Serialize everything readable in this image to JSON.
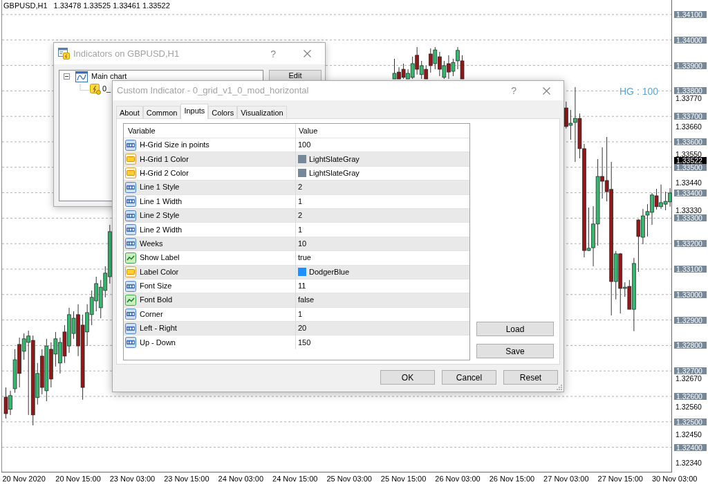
{
  "chart": {
    "symbol": "GBPUSD,H1",
    "quote": "1.33478 1.33525 1.33461 1.33522",
    "object_label": "HG : 100",
    "price_levels": [
      "1.34100",
      "1.34000",
      "1.33900",
      "1.33800",
      "1.33700",
      "1.33600",
      "1.33500",
      "1.33400",
      "1.33300",
      "1.33200",
      "1.33100",
      "1.33000",
      "1.32900",
      "1.32800",
      "1.32700",
      "1.32600",
      "1.32500",
      "1.32400"
    ],
    "current_price": "1.33522",
    "chart_data": {
      "type": "candlestick",
      "categories": [
        null,
        null,
        null,
        null,
        "20 Nov 2020",
        null,
        null,
        null,
        null,
        null,
        null,
        null,
        null,
        null,
        null,
        null,
        "20 Nov 15:00",
        null,
        null,
        null,
        null,
        null,
        null,
        null,
        null,
        null,
        null,
        null,
        "23 Nov 03:00",
        null,
        null,
        null,
        null,
        null,
        null,
        null,
        null,
        null,
        null,
        null,
        "23 Nov 15:00",
        null,
        null,
        null,
        null,
        null,
        null,
        null,
        null,
        null,
        null,
        null,
        "24 Nov 03:00",
        null,
        null,
        null,
        null,
        null,
        null,
        null,
        null,
        null,
        null,
        null,
        "24 Nov 15:00",
        null,
        null,
        null,
        null,
        null,
        null,
        null,
        null,
        null,
        null,
        null,
        "25 Nov 03:00",
        null,
        null,
        null,
        null,
        null,
        null,
        null,
        null,
        null,
        null,
        null,
        "25 Nov 15:00",
        null,
        null,
        null,
        null,
        null,
        null,
        null,
        null,
        null,
        null,
        null,
        "26 Nov 03:00",
        null,
        null,
        null,
        null,
        null,
        null,
        null,
        null,
        null,
        null,
        null,
        "26 Nov 15:00",
        null,
        null,
        null,
        null,
        null,
        null,
        null,
        null,
        null,
        null,
        null,
        "27 Nov 03:00",
        null,
        null,
        null,
        null,
        null,
        null,
        null,
        null,
        null,
        null,
        null,
        "27 Nov 15:00",
        null,
        null,
        null,
        null,
        null,
        null,
        null,
        null,
        null,
        null,
        null,
        "30 Nov 03:00"
      ],
      "ohlc": [
        [
          1.32597,
          1.32635,
          1.32513,
          1.32532
        ],
        [
          1.32549,
          1.32622,
          1.32527,
          1.32603
        ],
        [
          1.3263,
          1.32785,
          1.32614,
          1.32744
        ],
        [
          1.32804,
          1.32831,
          1.32635,
          1.3269
        ],
        [
          1.32777,
          1.32847,
          1.32744,
          1.32826
        ],
        [
          1.32812,
          1.32858,
          1.32527,
          1.32837
        ],
        [
          1.3282,
          1.32839,
          1.32486,
          1.32527
        ],
        [
          1.32595,
          1.32731,
          1.32568,
          1.3269
        ],
        [
          1.32758,
          1.32785,
          1.32608,
          1.32635
        ],
        [
          1.32622,
          1.32826,
          1.32581,
          1.32798
        ],
        [
          1.32785,
          1.32812,
          1.32635,
          1.32668
        ],
        [
          1.32766,
          1.32853,
          1.32717,
          1.32826
        ],
        [
          1.32731,
          1.32831,
          1.3269,
          1.32812
        ],
        [
          1.32853,
          1.3288,
          1.32731,
          1.32758
        ],
        [
          1.32798,
          1.32948,
          1.32771,
          1.32921
        ],
        [
          1.32847,
          1.32934,
          1.32826,
          1.32907
        ],
        [
          1.32921,
          1.32962,
          1.32758,
          1.32798
        ],
        [
          1.3288,
          1.32921,
          1.32587,
          1.32635
        ],
        [
          1.32853,
          1.32962,
          1.32798,
          1.32929
        ],
        [
          1.32921,
          1.33016,
          1.3288,
          1.32989
        ],
        [
          1.32975,
          1.3307,
          1.32934,
          1.33043
        ],
        [
          1.32948,
          1.33057,
          1.32907,
          1.33029
        ],
        [
          1.33016,
          1.33111,
          1.32989,
          1.33084
        ],
        [
          1.3307,
          1.33274,
          1.33043,
          1.33247
        ],
        null,
        null,
        null,
        null,
        null,
        null,
        null,
        null,
        null,
        null,
        null,
        null,
        null,
        null,
        null,
        null,
        null,
        null,
        null,
        null,
        null,
        null,
        null,
        null,
        null,
        null,
        null,
        null,
        null,
        null,
        null,
        null,
        null,
        null,
        null,
        null,
        null,
        null,
        null,
        null,
        null,
        null,
        null,
        null,
        null,
        null,
        null,
        null,
        null,
        null,
        null,
        null,
        null,
        null,
        null,
        null,
        null,
        null,
        null,
        null,
        null,
        null,
        [
          1.33847,
          1.33926,
          1.33847,
          1.33869
        ],
        [
          1.33874,
          1.33893,
          1.33847,
          1.33847
        ],
        [
          1.33885,
          1.33907,
          1.33847,
          1.33853
        ],
        [
          1.33847,
          1.33885,
          1.33847,
          1.33869
        ],
        [
          1.33853,
          1.33934,
          1.33847,
          1.33907
        ],
        [
          1.3394,
          1.33972,
          1.33864,
          1.33885
        ],
        [
          1.33864,
          1.33918,
          1.33847,
          1.33899
        ],
        [
          1.33885,
          1.33899,
          1.33847,
          1.33847
        ],
        [
          1.33945,
          1.33967,
          1.33872,
          1.33899
        ],
        [
          1.33907,
          1.33972,
          1.33885,
          1.33961
        ],
        [
          1.33934,
          1.33953,
          1.33858,
          1.33885
        ],
        [
          1.33853,
          1.33918,
          1.33847,
          1.33899
        ],
        [
          1.33907,
          1.3394,
          1.33847,
          1.33874
        ],
        [
          1.33877,
          1.33926,
          1.33858,
          1.33912
        ],
        [
          1.33918,
          1.33972,
          1.33885,
          1.33959
        ],
        [
          1.33918,
          1.3394,
          1.33847,
          1.33847
        ],
        null,
        null,
        null,
        null,
        null,
        null,
        null,
        null,
        null,
        null,
        null,
        null,
        null,
        null,
        null,
        null,
        null,
        null,
        null,
        null,
        null,
        null,
        [
          1.33733,
          1.33758,
          1.33652,
          1.3366
        ],
        [
          1.33665,
          1.33725,
          1.33608,
          1.33673
        ],
        [
          1.33676,
          1.33815,
          1.33521,
          1.33692
        ],
        [
          1.33692,
          1.33711,
          1.33535,
          1.33573
        ],
        [
          1.33573,
          1.33592,
          1.33146,
          1.33173
        ],
        [
          1.33173,
          1.33342,
          1.33171,
          1.33182
        ],
        [
          1.33184,
          1.33347,
          1.33111,
          1.33277
        ],
        [
          1.33277,
          1.33532,
          1.33192,
          1.33464
        ],
        [
          1.33464,
          1.33578,
          1.33377,
          1.33445
        ],
        [
          1.33448,
          1.33619,
          1.33366,
          1.33404
        ],
        [
          1.33413,
          1.33521,
          1.32918,
          1.33051
        ],
        [
          1.33051,
          1.33171,
          1.32981,
          1.3316
        ],
        [
          1.3316,
          1.33163,
          1.32926,
          1.33024
        ],
        [
          1.33024,
          1.33048,
          1.32991,
          1.33029
        ],
        [
          1.33032,
          1.33057,
          1.32942,
          1.32942
        ],
        [
          1.32942,
          1.33144,
          1.32856,
          1.33122
        ],
        [
          1.33293,
          1.33296,
          1.33089,
          1.33228
        ],
        [
          1.33225,
          1.33336,
          1.33198,
          1.33309
        ],
        [
          1.33312,
          1.33355,
          1.33228,
          1.33326
        ],
        [
          1.33323,
          1.33399,
          1.33274,
          1.33391
        ],
        [
          1.33388,
          1.33415,
          1.33334,
          1.33345
        ],
        [
          1.33345,
          1.33432,
          1.33336,
          1.33361
        ],
        [
          1.33355,
          1.33404,
          1.33331,
          1.33366
        ],
        [
          1.33364,
          1.33418,
          1.33345,
          1.33399
        ],
        null
      ],
      "ylim": [
        1.32301,
        1.34157
      ],
      "yticks": [
        {
          "value": 1.3377,
          "label": "1.33770"
        },
        {
          "value": 1.3366,
          "label": "1.33660"
        },
        {
          "value": 1.3355,
          "label": "1.33550"
        },
        {
          "value": 1.3344,
          "label": "1.33440"
        },
        {
          "value": 1.3333,
          "label": "1.33330"
        },
        {
          "value": 1.3267,
          "label": "1.32670"
        },
        {
          "value": 1.3256,
          "label": "1.32560"
        },
        {
          "value": 1.3245,
          "label": "1.32450"
        },
        {
          "value": 1.3234,
          "label": "1.32340"
        }
      ]
    }
  },
  "indicators_dialog": {
    "title": "Indicators on GBPUSD,H1",
    "help": "?",
    "tree": [
      {
        "label": "Main chart",
        "expanded": true,
        "children": [
          {
            "label": "0_"
          }
        ]
      }
    ],
    "buttons": [
      "Edit"
    ]
  },
  "custom_indicator_dialog": {
    "title": "Custom Indicator - 0_grid_v1_0_mod_horizontal",
    "help": "?",
    "tabs": [
      {
        "label": "About",
        "selected": false
      },
      {
        "label": "Common",
        "selected": false
      },
      {
        "label": "Inputs",
        "selected": true
      },
      {
        "label": "Colors",
        "selected": false
      },
      {
        "label": "Visualization",
        "selected": false
      }
    ],
    "table": {
      "columns": [
        "Variable",
        "Value"
      ],
      "rows": [
        {
          "kind": "number",
          "variable": "H-Grid Size in points",
          "value": "100"
        },
        {
          "kind": "color",
          "variable": "H-Grid 1 Color",
          "value": "LightSlateGray",
          "color": "#778899"
        },
        {
          "kind": "color",
          "variable": "H-Grid 2 Color",
          "value": "LightSlateGray",
          "color": "#778899"
        },
        {
          "kind": "number",
          "variable": "Line 1 Style",
          "value": "2"
        },
        {
          "kind": "number",
          "variable": "Line 1 Width",
          "value": "1"
        },
        {
          "kind": "number",
          "variable": "Line 2 Style",
          "value": "2"
        },
        {
          "kind": "number",
          "variable": "Line 2 Width",
          "value": "1"
        },
        {
          "kind": "number",
          "variable": "Weeks",
          "value": "10"
        },
        {
          "kind": "bool",
          "variable": "Show Label",
          "value": "true"
        },
        {
          "kind": "color",
          "variable": "Label Color",
          "value": "DodgerBlue",
          "color": "#1e90ff"
        },
        {
          "kind": "number",
          "variable": "Font Size",
          "value": "11"
        },
        {
          "kind": "bool",
          "variable": "Font Bold",
          "value": "false"
        },
        {
          "kind": "number",
          "variable": "Corner",
          "value": "1"
        },
        {
          "kind": "number",
          "variable": "Left - Right",
          "value": "20"
        },
        {
          "kind": "number",
          "variable": "Up - Down",
          "value": "150"
        }
      ]
    },
    "side_buttons": [
      "Load",
      "Save"
    ],
    "buttons": [
      "OK",
      "Cancel",
      "Reset"
    ]
  }
}
